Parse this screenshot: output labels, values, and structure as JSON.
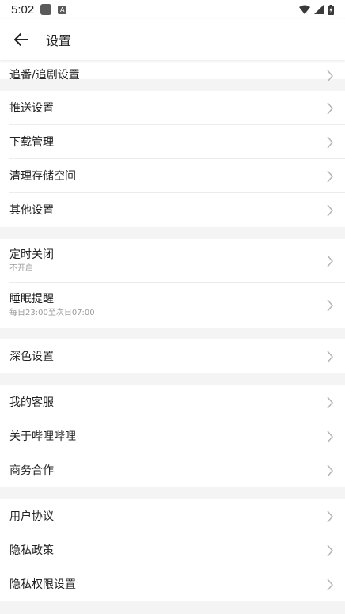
{
  "status_bar": {
    "time": "5:02",
    "app_icon_letter": "A"
  },
  "header": {
    "title": "设置"
  },
  "groups": [
    {
      "items": [
        {
          "label": "追番/追剧设置"
        }
      ]
    },
    {
      "items": [
        {
          "label": "推送设置"
        },
        {
          "label": "下载管理"
        },
        {
          "label": "清理存储空间"
        },
        {
          "label": "其他设置"
        }
      ]
    },
    {
      "items": [
        {
          "label": "定时关闭",
          "sub": "不开启"
        },
        {
          "label": "睡眠提醒",
          "sub": "每日23:00至次日07:00"
        }
      ]
    },
    {
      "items": [
        {
          "label": "深色设置"
        }
      ]
    },
    {
      "items": [
        {
          "label": "我的客服"
        },
        {
          "label": "关于哔哩哔哩"
        },
        {
          "label": "商务合作"
        }
      ]
    },
    {
      "items": [
        {
          "label": "用户协议"
        },
        {
          "label": "隐私政策"
        },
        {
          "label": "隐私权限设置"
        }
      ]
    }
  ],
  "colors": {
    "page_background": "#f4f4f4",
    "row_background": "#ffffff",
    "text_primary": "#212121",
    "text_secondary": "#9a9a9a",
    "chevron": "#b5b5b5"
  }
}
